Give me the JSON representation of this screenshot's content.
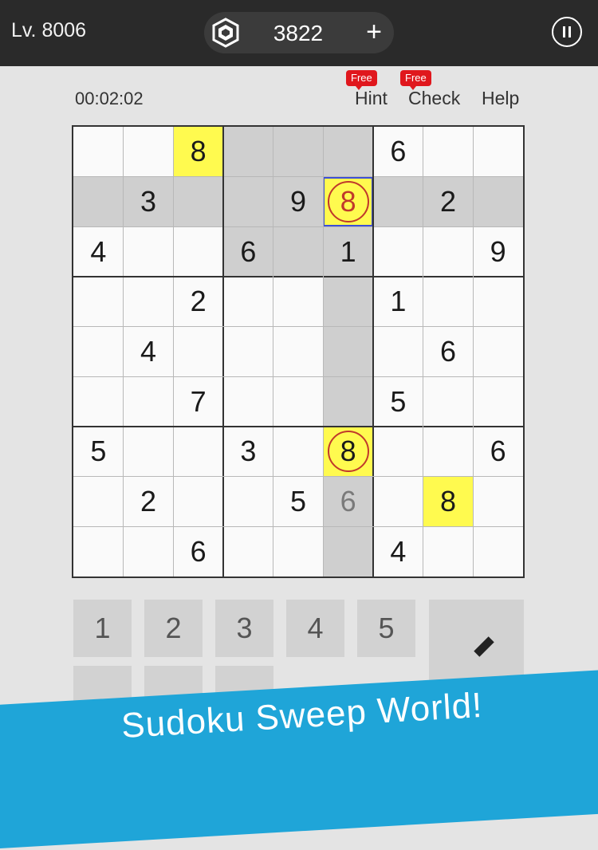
{
  "header": {
    "level": "Lv. 8006",
    "coins": "3822",
    "add_label": "+"
  },
  "info": {
    "timer": "00:02:02",
    "hint_label": "Hint",
    "check_label": "Check",
    "help_label": "Help",
    "hint_badge": "Free",
    "check_badge": "Free"
  },
  "board": {
    "rows": [
      [
        "",
        "",
        "8",
        "",
        "",
        "",
        "6",
        "",
        ""
      ],
      [
        "",
        "3",
        "",
        "",
        "9",
        "8",
        "",
        "2",
        ""
      ],
      [
        "4",
        "",
        "",
        "6",
        "",
        "1",
        "",
        "",
        "9"
      ],
      [
        "",
        "",
        "2",
        "",
        "",
        "",
        "1",
        "",
        ""
      ],
      [
        "",
        "4",
        "",
        "",
        "",
        "",
        "",
        "6",
        ""
      ],
      [
        "",
        "",
        "7",
        "",
        "",
        "",
        "5",
        "",
        ""
      ],
      [
        "5",
        "",
        "",
        "3",
        "",
        "8",
        "",
        "",
        "6"
      ],
      [
        "",
        "2",
        "",
        "",
        "5",
        "6",
        "",
        "8",
        ""
      ],
      [
        "",
        "",
        "6",
        "",
        "",
        "",
        "4",
        "",
        ""
      ]
    ],
    "selected_cell": [
      1,
      5
    ],
    "highlight_color": "#fffa4f",
    "shade_color": "#cfcfcf",
    "selection_color": "#3d4fd6",
    "ring_color": "#c0392b",
    "yellow_cells": [
      [
        0,
        2
      ],
      [
        1,
        5
      ],
      [
        6,
        5
      ],
      [
        7,
        7
      ]
    ],
    "ringed_cells": [
      [
        1,
        5
      ],
      [
        6,
        5
      ]
    ],
    "user_entered_cells": [
      [
        7,
        5
      ]
    ]
  },
  "keypad": {
    "keys": [
      "1",
      "2",
      "3",
      "4",
      "5"
    ]
  },
  "banner": {
    "text": "Sudoku Sweep World!",
    "color": "#1fa5d8"
  }
}
